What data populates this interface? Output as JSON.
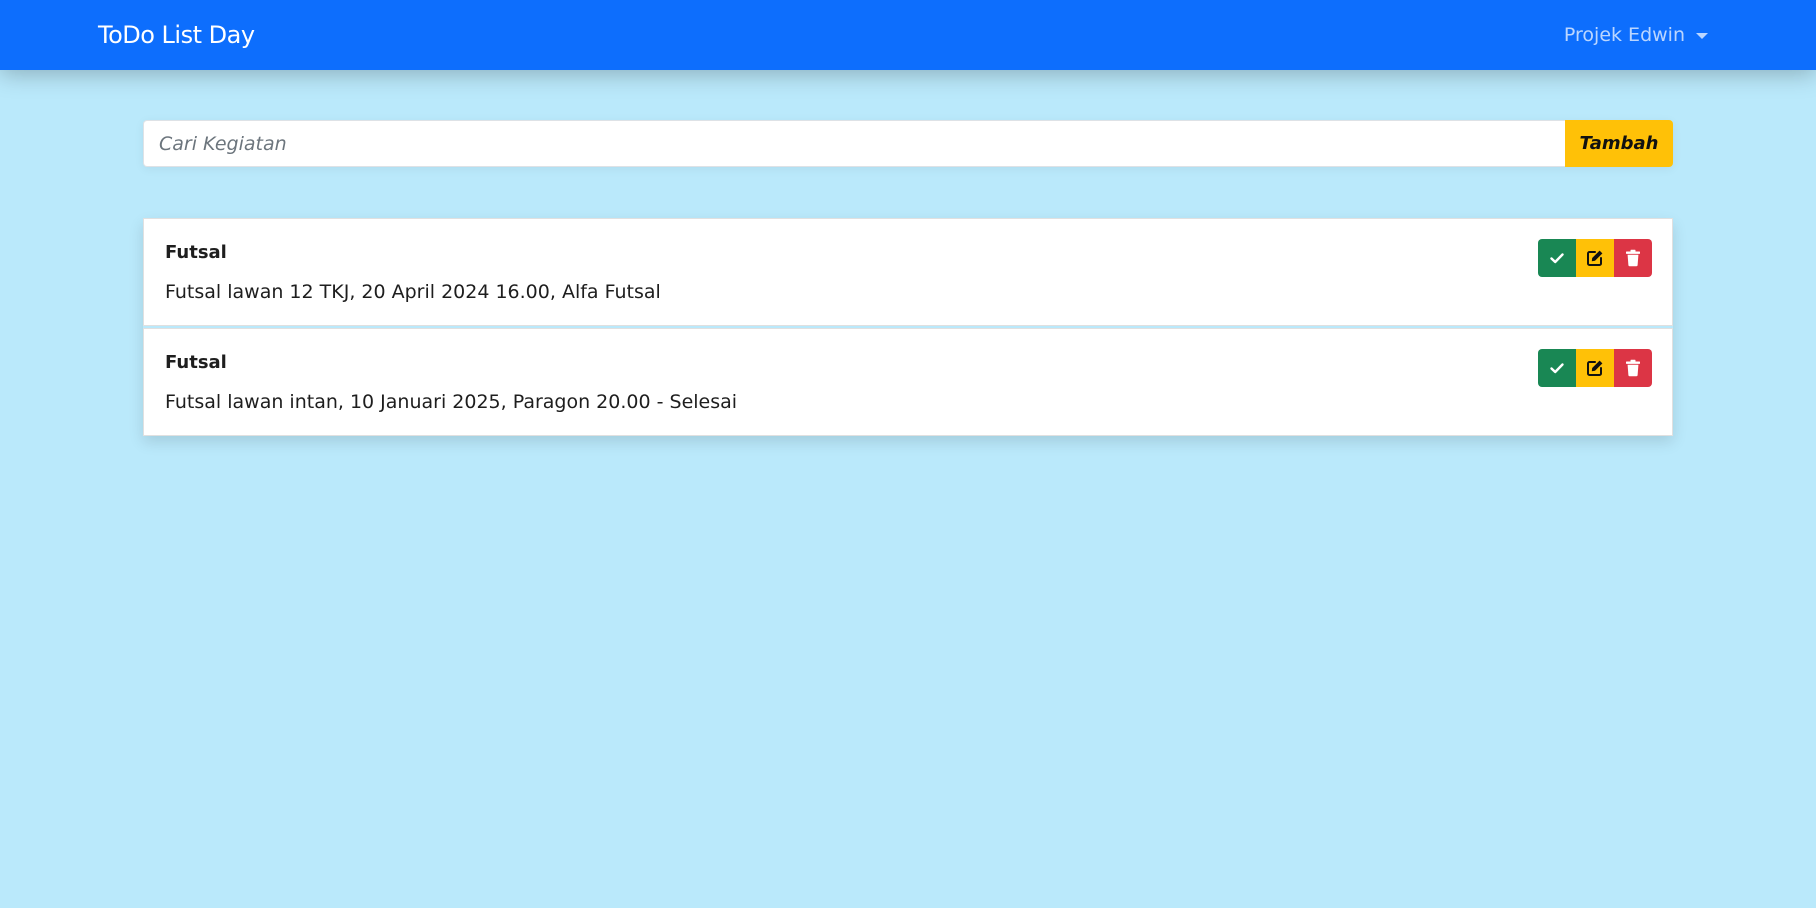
{
  "navbar": {
    "brand": "ToDo List Day",
    "dropdown_label": "Projek Edwin"
  },
  "search": {
    "placeholder": "Cari Kegiatan",
    "value": "",
    "add_label": "Tambah"
  },
  "todos": [
    {
      "title": "Futsal",
      "description": "Futsal lawan 12 TKJ, 20 April 2024 16.00, Alfa Futsal"
    },
    {
      "title": "Futsal",
      "description": "Futsal lawan intan, 10 Januari 2025, Paragon 20.00 - Selesai"
    }
  ],
  "icons": {
    "done": "check-icon",
    "edit": "pencil-square-icon",
    "delete": "trash-icon"
  },
  "colors": {
    "navbar": "#0d6efd",
    "background": "#bae9fb",
    "warning": "#ffc107",
    "success": "#198754",
    "danger": "#dc3545"
  }
}
